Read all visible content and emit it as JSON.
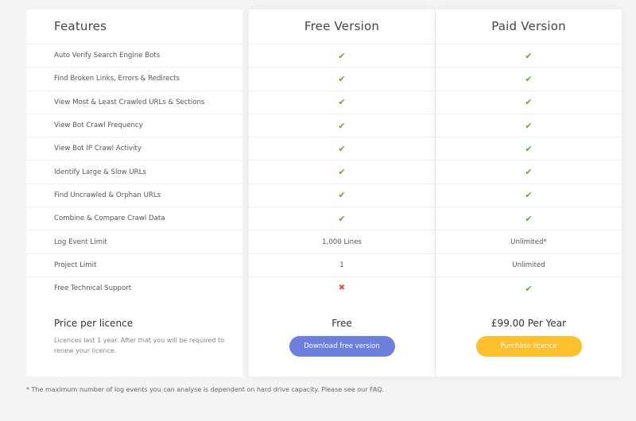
{
  "headers": {
    "features": "Features",
    "free": "Free Version",
    "paid": "Paid Version"
  },
  "rows": [
    {
      "feature": "Auto Verify Search Engine Bots",
      "free": {
        "type": "check"
      },
      "paid": {
        "type": "check"
      }
    },
    {
      "feature": "Find Broken Links, Errors & Redirects",
      "free": {
        "type": "check"
      },
      "paid": {
        "type": "check"
      }
    },
    {
      "feature": "View Most & Least Crawled URLs & Sections",
      "free": {
        "type": "check"
      },
      "paid": {
        "type": "check"
      }
    },
    {
      "feature": "View Bot Crawl Frequency",
      "free": {
        "type": "check"
      },
      "paid": {
        "type": "check"
      }
    },
    {
      "feature": "View Bot IP Crawl Activity",
      "free": {
        "type": "check"
      },
      "paid": {
        "type": "check"
      }
    },
    {
      "feature": "Identify Large & Slow URLs",
      "free": {
        "type": "check"
      },
      "paid": {
        "type": "check"
      }
    },
    {
      "feature": "Find Uncrawled & Orphan URLs",
      "free": {
        "type": "check"
      },
      "paid": {
        "type": "check"
      }
    },
    {
      "feature": "Combine & Compare Crawl Data",
      "free": {
        "type": "check"
      },
      "paid": {
        "type": "check"
      }
    },
    {
      "feature": "Log Event Limit",
      "free": {
        "type": "text",
        "value": "1,000 Lines"
      },
      "paid": {
        "type": "text",
        "value": "Unlimited*"
      }
    },
    {
      "feature": "Project Limit",
      "free": {
        "type": "text",
        "value": "1"
      },
      "paid": {
        "type": "text",
        "value": "Unlimited"
      }
    },
    {
      "feature": "Free Technical Support",
      "free": {
        "type": "cross"
      },
      "paid": {
        "type": "check"
      }
    }
  ],
  "icons": {
    "check": "check-icon",
    "cross": "cross-icon",
    "check_color": "#6ea53f",
    "cross_color": "#d9534f"
  },
  "price": {
    "title": "Price per licence",
    "note": "Licences last 1 year. After that you will be required to renew your licence.",
    "free_value": "Free",
    "paid_value": "£99.00 Per Year",
    "free_button": "Download free version",
    "paid_button": "Purchase licence"
  },
  "colors": {
    "free_button": "#6c7fdd",
    "paid_button": "#fcc12d"
  },
  "footnote": "* The maximum number of log events you can analyse is dependent on hard drive capacity. Please see our FAQ."
}
